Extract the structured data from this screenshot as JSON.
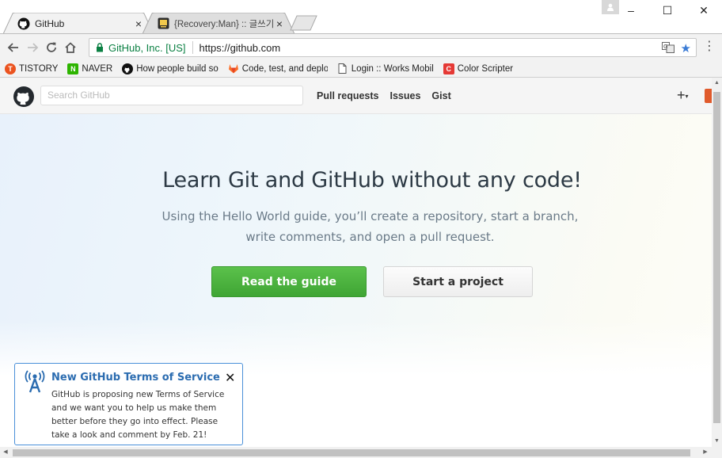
{
  "browser": {
    "tabs": [
      {
        "title": "GitHub",
        "active": true,
        "close": "×"
      },
      {
        "title": "{Recovery:Man} :: 글쓰기",
        "active": false,
        "close": "×"
      }
    ],
    "window_controls": {
      "minimize": "–",
      "maximize": "☐",
      "close": "✕"
    },
    "omnibox": {
      "origin": "GitHub, Inc. [US]",
      "url": "https://github.com"
    },
    "bookmarks": [
      {
        "label": "TISTORY",
        "icon": "tistory-icon",
        "color": "#eb531f",
        "glyph": "T"
      },
      {
        "label": "NAVER",
        "icon": "naver-icon",
        "color": "#2db400",
        "glyph": "N"
      },
      {
        "label": "How people build so",
        "icon": "github-icon",
        "color": "#111111",
        "glyph": ""
      },
      {
        "label": "Code, test, and deplo",
        "icon": "gitlab-icon",
        "color": "#fc6d26",
        "glyph": ""
      },
      {
        "label": "Login :: Works Mobil",
        "icon": "page-icon",
        "color": "#ffffff",
        "glyph": ""
      },
      {
        "label": "Color Scripter",
        "icon": "colorscripter-icon",
        "color": "#e53935",
        "glyph": "C"
      }
    ]
  },
  "github": {
    "search_placeholder": "Search GitHub",
    "nav": [
      "Pull requests",
      "Issues",
      "Gist"
    ],
    "plus": "+",
    "plus_caret": "▾",
    "hero": {
      "title": "Learn Git and GitHub without any code!",
      "subtitle_line1": "Using the Hello World guide, you’ll create a repository, start a branch,",
      "subtitle_line2": "write comments, and open a pull request.",
      "primary_button": "Read the guide",
      "secondary_button": "Start a project"
    },
    "notice": {
      "title": "New GitHub Terms of Service",
      "body": "GitHub is proposing new Terms of Service and we want you to help us make them better before they go into effect. Please take a look and comment by Feb. 21!",
      "close": "✕"
    }
  },
  "colors": {
    "primary_green": "#4bb33e",
    "notice_border": "#4a90d9",
    "link_blue": "#2b6cb0",
    "secure_green": "#0b8043"
  }
}
